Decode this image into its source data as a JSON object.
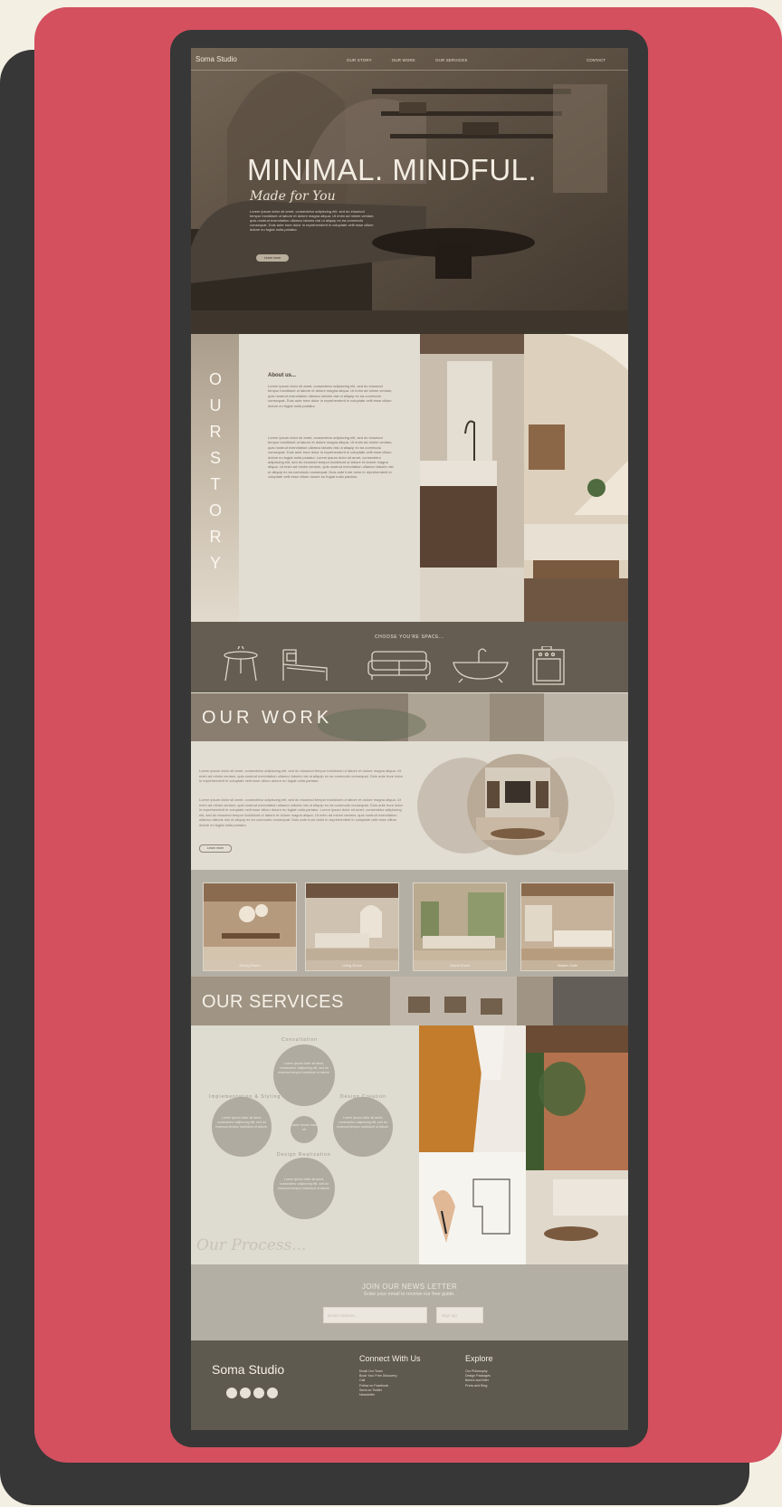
{
  "nav": {
    "brand": "Soma Studio",
    "links": [
      "OUR STORY",
      "OUR WORK",
      "OUR SERVICES"
    ],
    "contact": "CONTACT"
  },
  "hero": {
    "title": "MINIMAL. MINDFUL.",
    "subtitle": "Made for You",
    "paragraph": "Lorem ipsum dolor sit amet, consectetur adipiscing elit, sed do eiusmod tempor incididunt ut labore et dolore magna aliqua. Ut enim ad minim veniam, quis nostrud exercitation ullamco laboris nisi ut aliquip ex ea commodo consequat. Duis aute irure dolor in reprehenderit in voluptate velit esse cillum dolore eu fugiat nulla pariatur.",
    "button": "Learn more"
  },
  "story": {
    "vertical_title": "OURSTORY",
    "about_label": "About us...",
    "paragraphs": [
      "Lorem ipsum dolor sit amet, consectetur adipiscing elit, sed do eiusmod tempor incididunt ut labore et dolore magna aliqua. Ut enim ad minim veniam, quis nostrud exercitation ullamco laboris nisi ut aliquip ex ea commodo consequat. Duis aute irure dolor in reprehenderit in voluptate velit esse cillum dolore eu fugiat nulla pariatur.",
      "Lorem ipsum dolor sit amet, consectetur adipiscing elit, sed do eiusmod tempor incididunt ut labore et dolore magna aliqua. Ut enim ad minim veniam, quis nostrud exercitation ullamco laboris nisi ut aliquip ex ea commodo consequat. Duis aute irure dolor in reprehenderit in voluptate velit esse cillum dolore eu fugiat nulla pariatur. Lorem ipsum dolor sit amet, consectetur adipiscing elit, sed do eiusmod tempor incididunt ut labore et dolore magna aliqua. Ut enim ad minim veniam, quis nostrud exercitation ullamco laboris nisi ut aliquip ex ea commodo consequat. Duis aute irure dolor in reprehenderit in voluptate velit esse cillum dolore eu fugiat nulla pariatur."
    ]
  },
  "choose": {
    "title": "CHOOSE YOU'RE SPACE...",
    "icons": [
      "dining-table-icon",
      "bed-icon",
      "sofa-icon",
      "bathtub-icon",
      "kitchen-stove-icon"
    ]
  },
  "work": {
    "title": "OUR WORK",
    "paragraphs": [
      "Lorem ipsum dolor sit amet, consectetur adipiscing elit, sed do eiusmod tempor incididunt ut labore et dolore magna aliqua. Ut enim ad minim veniam, quis nostrud exercitation ullamco laboris nisi ut aliquip ex ea commodo consequat. Duis aute irure dolor in reprehenderit in voluptate velit esse cillum dolore eu fugiat nulla pariatur.",
      "Lorem ipsum dolor sit amet, consectetur adipiscing elit, sed do eiusmod tempor incididunt ut labore et dolore magna aliqua. Ut enim ad minim veniam, quis nostrud exercitation ullamco laboris nisi ut aliquip ex ea commodo consequat. Duis aute irure dolor in reprehenderit in voluptate velit esse cillum dolore eu fugiat nulla pariatur. Lorem ipsum dolor sit amet, consectetur adipiscing elit, sed do eiusmod tempor incididunt ut labore et dolore magna aliqua. Ut enim ad minim veniam, quis nostrud exercitation ullamco laboris nisi ut aliquip ex ea commodo consequat. Duis aute irure dolor in reprehenderit in voluptate velit esse cillum dolore eu fugiat nulla pariatur."
    ],
    "button": "Learn more",
    "gallery": [
      "Dining Room",
      "Living Room",
      "Guest Room",
      "Master Suite"
    ]
  },
  "services": {
    "title": "OUR SERVICES",
    "process_title": "Our Process...",
    "steps": [
      {
        "label": "Consultation",
        "text": "Lorem ipsum dolor sit amet, consectetur adipiscing elit, sed do eiusmod tempor incididunt ut labore."
      },
      {
        "label": "Design Creation",
        "text": "Lorem ipsum dolor sit amet, consectetur adipiscing elit, sed do eiusmod tempor incididunt ut labore."
      },
      {
        "label": "Design Realization",
        "text": "Lorem ipsum dolor sit amet, consectetur adipiscing elit, sed do eiusmod tempor incididunt ut labore."
      },
      {
        "label": "Implementation & Styling",
        "text": "Lorem ipsum dolor sit amet, consectetur adipiscing elit, sed do eiusmod tempor incididunt ut labore."
      }
    ],
    "center_text": "Lorem ipsum dolor sit"
  },
  "newsletter": {
    "title": "JOIN OUR NEWS LETTER",
    "subtitle": "Enter your email to receive our free guide.",
    "placeholder": "Email Address...",
    "button": "Sign up!"
  },
  "footer": {
    "brand": "Soma Studio",
    "connect_title": "Connect With Us",
    "connect_links": [
      "Email Our Team",
      "Book Your Free Discovery",
      "Call",
      "Follow on Facebook",
      "Send on Twitter",
      "Newsletter"
    ],
    "explore_title": "Explore",
    "explore_links": [
      "Our Philosophy",
      "Design Packages",
      "Before and After",
      "Press and Blog"
    ]
  },
  "colors": {
    "frame_pink": "#d4505f",
    "frame_dark": "#373737",
    "background_cream": "#f3f0e3",
    "taupe_dark": "#655d51",
    "taupe_light": "#b3afa4",
    "cream_panel": "#e1ddd2"
  }
}
